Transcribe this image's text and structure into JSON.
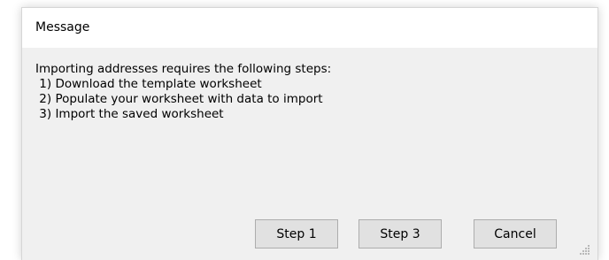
{
  "dialog": {
    "title": "Message",
    "message_lines": [
      "Importing addresses requires the following steps:",
      " 1) Download the template worksheet",
      " 2) Populate your worksheet with data to import",
      " 3) Import the saved worksheet"
    ],
    "buttons": {
      "step1": "Step 1",
      "step3": "Step 3",
      "cancel": "Cancel"
    }
  },
  "icons": {
    "resize_grip": "resize-grip-icon"
  }
}
